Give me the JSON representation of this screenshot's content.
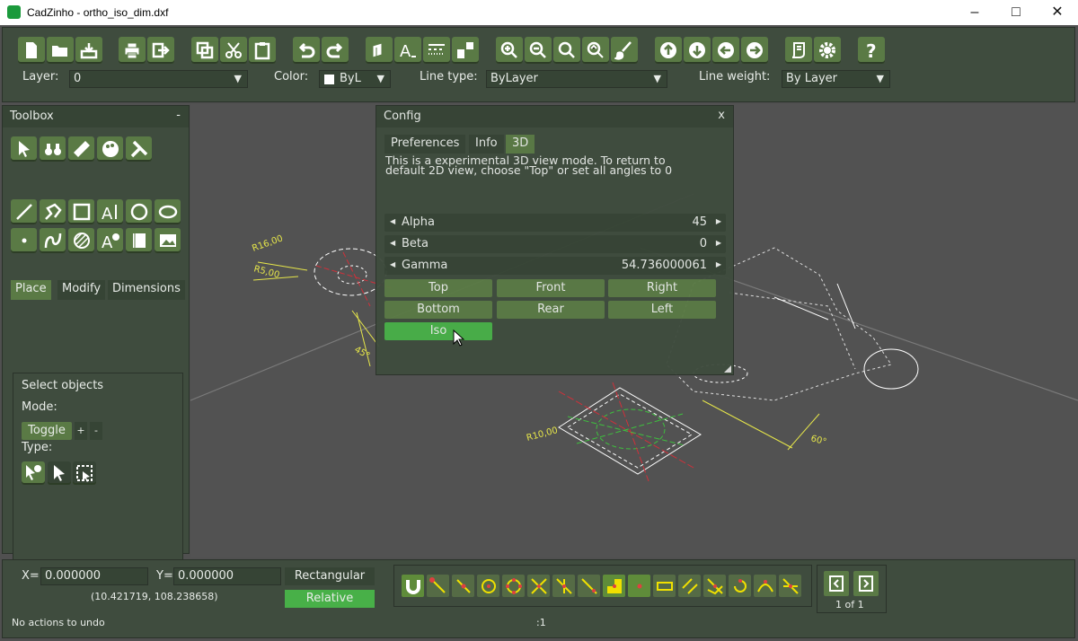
{
  "window": {
    "title": "CadZinho - ortho_iso_dim.dxf"
  },
  "toolbar": {
    "layer_label": "Layer:",
    "layer_value": "0",
    "color_label": "Color:",
    "color_value": "ByL",
    "linetype_label": "Line type:",
    "linetype_value": "ByLayer",
    "lineweight_label": "Line weight:",
    "lineweight_value": "By Layer",
    "icons": [
      "new-file-icon",
      "open-folder-icon",
      "save-icon",
      "print-icon",
      "export-icon",
      "copy-icon",
      "cut-icon",
      "paste-icon",
      "undo-icon",
      "redo-icon",
      "layers-icon",
      "text-style-icon",
      "line-type-icon",
      "block-icon",
      "zoom-in-icon",
      "zoom-out-icon",
      "zoom-window-icon",
      "zoom-extents-icon",
      "brush-icon",
      "pan-up-icon",
      "pan-down-icon",
      "pan-left-icon",
      "pan-right-icon",
      "script-icon",
      "settings-gear-icon",
      "help-icon"
    ]
  },
  "toolbox": {
    "title": "Toolbox",
    "collapse": "-",
    "tabs": [
      "Place",
      "Modify",
      "Dimensions"
    ],
    "select_title": "Select objects",
    "mode_label": "Mode:",
    "toggle_label": "Toggle",
    "plus": "+",
    "minus": "-",
    "type_label": "Type:"
  },
  "config": {
    "title": "Config",
    "close": "x",
    "tabs": [
      "Preferences",
      "Info",
      "3D"
    ],
    "desc_line1": "This is a experimental 3D view mode. To return to",
    "desc_line2": "default 2D view, choose \"Top\" or set all angles to 0",
    "alpha_label": "Alpha",
    "alpha_value": "45",
    "beta_label": "Beta",
    "beta_value": "0",
    "gamma_label": "Gamma",
    "gamma_value": "54.736000061",
    "views": [
      "Top",
      "Front",
      "Right",
      "Bottom",
      "Rear",
      "Left",
      "Iso"
    ]
  },
  "drawing": {
    "dims": [
      "R16,00",
      "R5,00",
      "45°",
      "R10,00",
      "R5,00",
      "60°"
    ]
  },
  "status": {
    "x_label": "X=",
    "x_value": "0.000000",
    "y_label": "Y=",
    "y_value": "0.000000",
    "rect_label": "Rectangular",
    "relative_label": "Relative",
    "coords": "(10.421719,  108.238658)",
    "undo_msg": "No actions to undo",
    "scale": ":1",
    "page": "1 of 1"
  },
  "colors": {
    "panel": "#3f4c3e",
    "button": "#5a7a45",
    "canvas": "#525252",
    "dim": "#e6e64a"
  }
}
